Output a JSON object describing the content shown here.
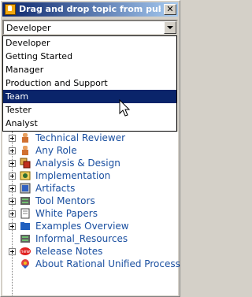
{
  "window": {
    "title": "Drag and drop topic from publi...",
    "close_label": "✕"
  },
  "combo": {
    "value": "Developer"
  },
  "dropdown": {
    "items": [
      {
        "label": "Developer",
        "selected": false
      },
      {
        "label": "Getting Started",
        "selected": false
      },
      {
        "label": "Manager",
        "selected": false
      },
      {
        "label": "Production and Support",
        "selected": false
      },
      {
        "label": "Team",
        "selected": true
      },
      {
        "label": "Tester",
        "selected": false
      },
      {
        "label": "Analyst",
        "selected": false
      }
    ]
  },
  "tree": {
    "items": [
      {
        "label": "Technical Reviewer",
        "icon": "person-icon"
      },
      {
        "label": "Any Role",
        "icon": "person-icon"
      },
      {
        "label": "Analysis & Design",
        "icon": "design-icon"
      },
      {
        "label": "Implementation",
        "icon": "implementation-icon"
      },
      {
        "label": "Artifacts",
        "icon": "artifacts-icon"
      },
      {
        "label": "Tool Mentors",
        "icon": "tools-icon"
      },
      {
        "label": "White Papers",
        "icon": "paper-icon"
      },
      {
        "label": "Examples Overview",
        "icon": "folder-icon"
      },
      {
        "label": "Informal_Resources",
        "icon": "resources-icon"
      },
      {
        "label": "Release Notes",
        "icon": "new-badge-icon"
      },
      {
        "label": "About Rational Unified Process",
        "icon": "rational-logo-icon"
      }
    ]
  },
  "colors": {
    "titlebar_start": "#0a246a",
    "titlebar_end": "#a6caf0",
    "selection": "#0a246a",
    "tree_text": "#1a4fa0",
    "chrome": "#d4d0c8"
  }
}
